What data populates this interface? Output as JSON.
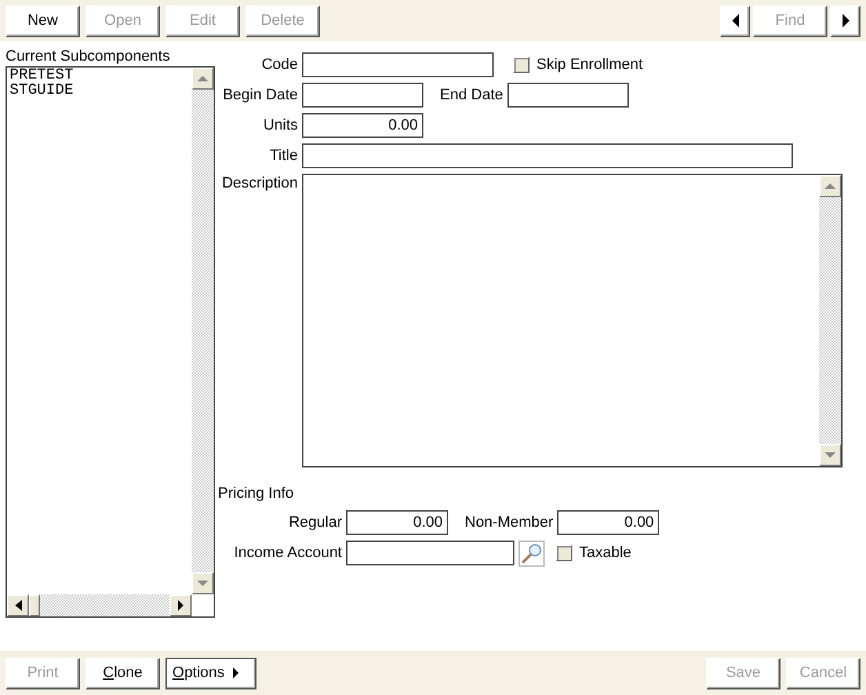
{
  "toolbar": {
    "buttons": [
      {
        "label": "New",
        "disabled": false
      },
      {
        "label": "Open",
        "disabled": true
      },
      {
        "label": "Edit",
        "disabled": true
      },
      {
        "label": "Delete",
        "disabled": true
      }
    ],
    "navigation": {
      "find": {
        "label": "Find",
        "disabled": true
      }
    }
  },
  "subcomponents": {
    "label": "Current Subcomponents",
    "items": [
      "PRETEST",
      "STGUIDE"
    ]
  },
  "form": {
    "code": {
      "label": "Code"
    },
    "skip_enrollment": {
      "label": "Skip Enrollment",
      "checked": false
    },
    "begin_date": {
      "label": "Begin Date"
    },
    "end_date": {
      "label": "End Date"
    },
    "units": {
      "label": "Units",
      "value": "0.00"
    },
    "title": {
      "label": "Title"
    },
    "description": {
      "label": "Description"
    }
  },
  "pricing": {
    "heading": "Pricing Info",
    "regular": {
      "label": "Regular",
      "value": "0.00"
    },
    "non_member": {
      "label": "Non-Member",
      "value": "0.00"
    },
    "income_account": {
      "label": "Income Account"
    },
    "taxable": {
      "label": "Taxable",
      "checked": false
    }
  },
  "footer": {
    "left": [
      {
        "label": "Print",
        "disabled": true,
        "mnemonic": false,
        "kind": "button"
      },
      {
        "label": "Clone",
        "disabled": false,
        "mnemonic": true,
        "kind": "button"
      },
      {
        "label": "Options",
        "disabled": false,
        "mnemonic": true,
        "kind": "menu"
      }
    ],
    "right": [
      {
        "label": "Save",
        "disabled": true,
        "mnemonic": false
      },
      {
        "label": "Cancel",
        "disabled": true,
        "mnemonic": false
      }
    ]
  }
}
